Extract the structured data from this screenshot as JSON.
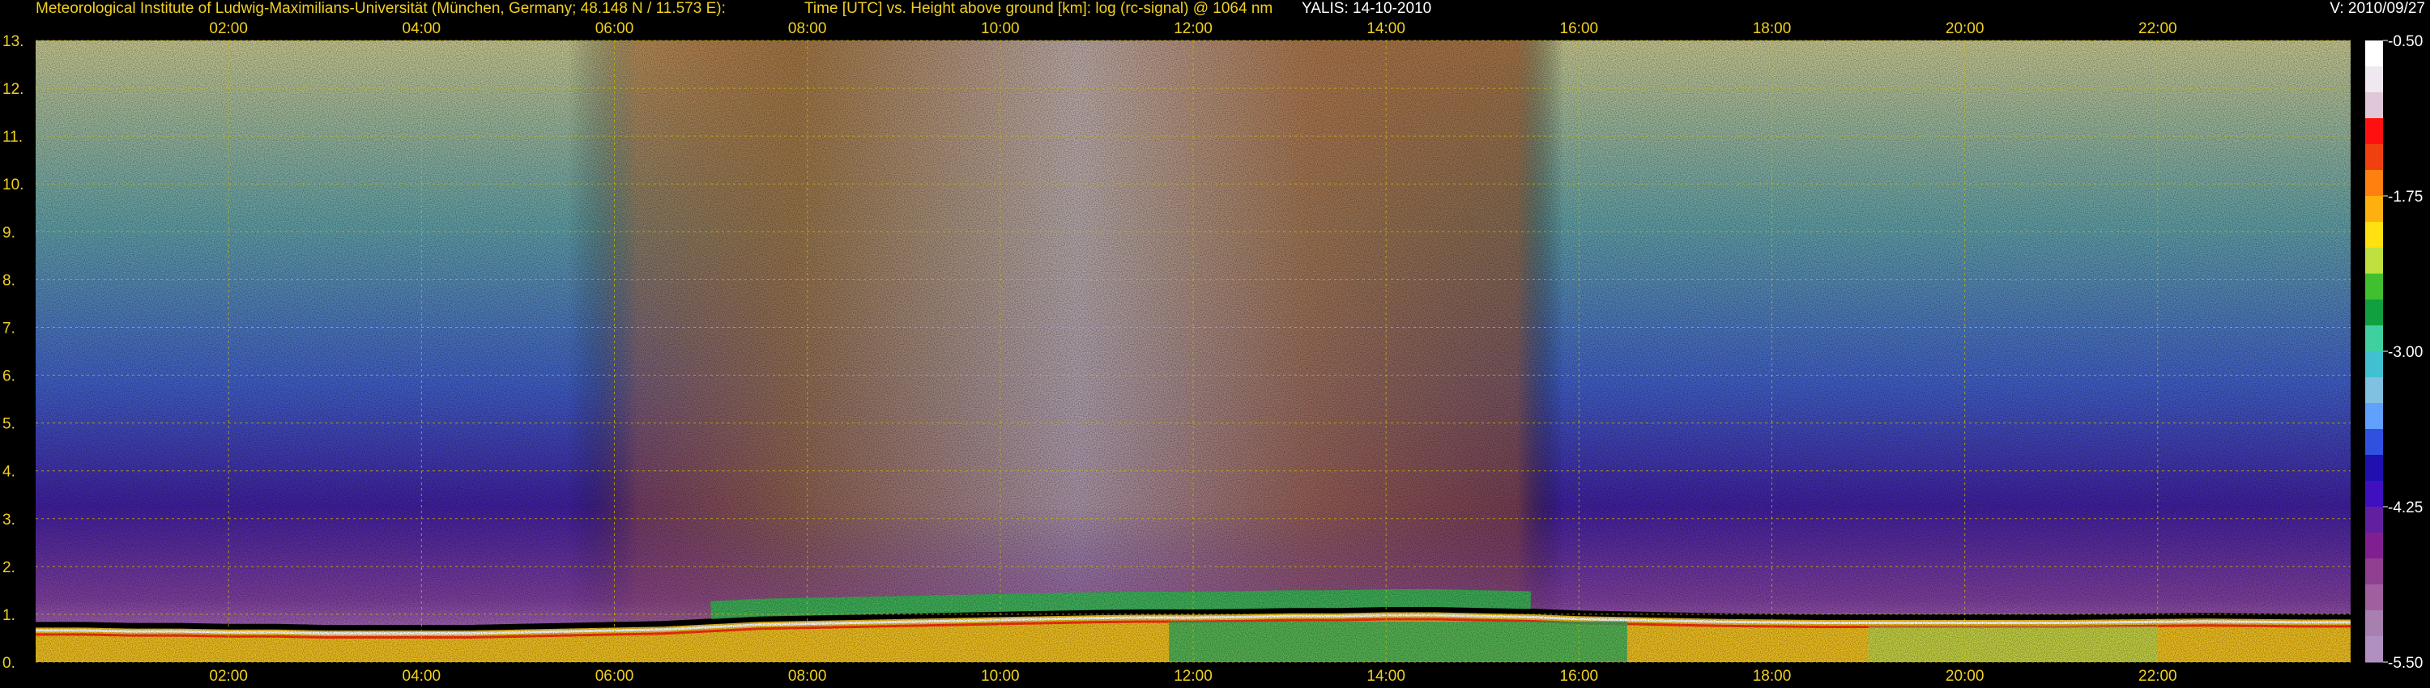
{
  "header": {
    "institute": "Meteorological Institute of Ludwig-Maximilians-Universität (München, Germany; 48.148 N / 11.573 E):",
    "axes_description": "Time [UTC] vs. Height above ground [km]: log (rc-signal) @ 1064 nm",
    "instrument_date": "YALIS: 14-10-2010",
    "version": "V: 2010/09/27"
  },
  "colors": {
    "background": "#000000",
    "axis_text": "#f0d020",
    "header_text": "#f0d020",
    "header_text_secondary": "#ffffff",
    "grid": "#c8b400"
  },
  "chart_data": {
    "type": "heatmap",
    "title": "Time [UTC] vs. Height above ground [km]: log (rc-signal) @ 1064 nm",
    "x": {
      "unit": "UTC",
      "range": [
        "00:00",
        "24:00"
      ],
      "tick_labels": [
        "02:00",
        "04:00",
        "06:00",
        "08:00",
        "10:00",
        "12:00",
        "14:00",
        "16:00",
        "18:00",
        "20:00",
        "22:00"
      ],
      "tick_values_h": [
        2,
        4,
        6,
        8,
        10,
        12,
        14,
        16,
        18,
        20,
        22
      ]
    },
    "y": {
      "unit": "km",
      "range": [
        0,
        13
      ],
      "tick_labels": [
        "0.",
        "1.",
        "2.",
        "3.",
        "4.",
        "5.",
        "6.",
        "7.",
        "8.",
        "9.",
        "10.",
        "11.",
        "12.",
        "13."
      ],
      "tick_values": [
        0,
        1,
        2,
        3,
        4,
        5,
        6,
        7,
        8,
        9,
        10,
        11,
        12,
        13
      ]
    },
    "grid": true,
    "colorbar": {
      "position": "right",
      "range": [
        -5.5,
        -0.5
      ],
      "tick_labels": [
        "-0.50",
        "-1.75",
        "-3.00",
        "-4.25",
        "-5.50"
      ],
      "tick_values": [
        -0.5,
        -1.75,
        -3.0,
        -4.25,
        -5.5
      ],
      "colors_top_to_bottom": [
        "#ffffff",
        "#f0e8f0",
        "#e0c8d8",
        "#ff1010",
        "#f04010",
        "#ff8010",
        "#ffb010",
        "#ffe010",
        "#c0e040",
        "#40c030",
        "#10a040",
        "#40d0a0",
        "#40c0d0",
        "#80c0e0",
        "#60a0ff",
        "#3050e0",
        "#2010b0",
        "#4010c0",
        "#6020a0",
        "#802090",
        "#904090",
        "#a060a0",
        "#a880b0",
        "#b090c0"
      ]
    },
    "layers": {
      "time_h": [
        0.0,
        0.5,
        1.0,
        1.5,
        2.0,
        2.5,
        3.0,
        3.5,
        4.0,
        4.5,
        5.0,
        5.5,
        6.0,
        6.5,
        7.0,
        7.5,
        8.0,
        8.5,
        9.0,
        9.5,
        10.0,
        10.5,
        11.0,
        11.5,
        12.0,
        12.5,
        13.0,
        13.5,
        14.0,
        14.5,
        15.0,
        15.5,
        16.0,
        16.5,
        17.0,
        17.5,
        18.0,
        18.5,
        19.0,
        19.5,
        20.0,
        20.5,
        21.0,
        21.5,
        22.0,
        22.5,
        23.0,
        23.5,
        24.0
      ],
      "boundary_layer_top_km": [
        0.78,
        0.78,
        0.76,
        0.76,
        0.74,
        0.74,
        0.72,
        0.72,
        0.72,
        0.72,
        0.74,
        0.76,
        0.78,
        0.8,
        0.85,
        0.9,
        0.92,
        0.94,
        0.96,
        0.98,
        1.0,
        1.02,
        1.04,
        1.05,
        1.05,
        1.06,
        1.08,
        1.08,
        1.1,
        1.1,
        1.08,
        1.06,
        1.02,
        1.0,
        0.98,
        0.96,
        0.95,
        0.94,
        0.94,
        0.94,
        0.94,
        0.94,
        0.94,
        0.95,
        0.96,
        0.97,
        0.96,
        0.95,
        0.95
      ]
    }
  }
}
